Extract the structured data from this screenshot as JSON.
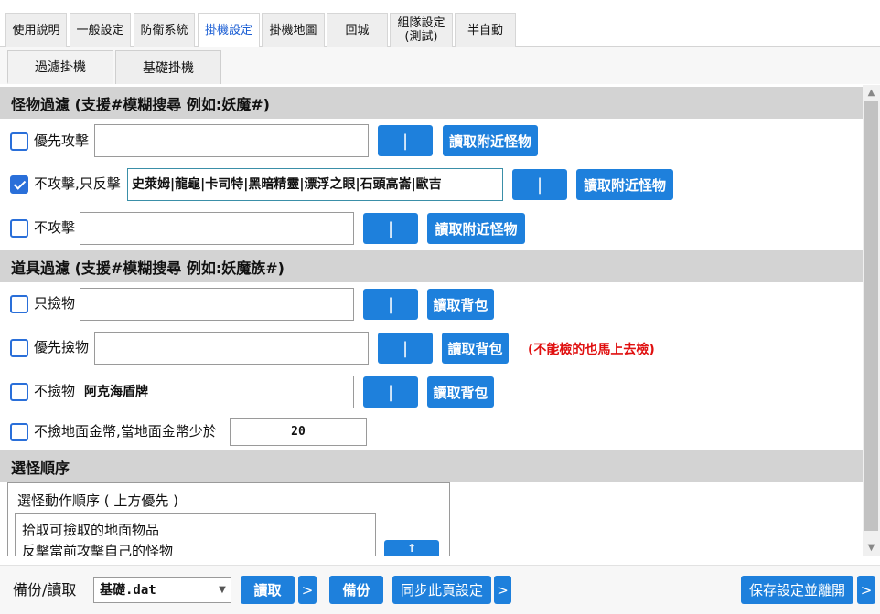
{
  "top_tabs": [
    {
      "label": "使用說明"
    },
    {
      "label": "一般設定"
    },
    {
      "label": "防衛系統"
    },
    {
      "label": "掛機設定"
    },
    {
      "label": "掛機地圖"
    },
    {
      "label": "回城"
    },
    {
      "label": "組隊設定\n(測試)"
    },
    {
      "label": "半自動"
    }
  ],
  "active_top_tab": "掛機設定",
  "sub_tabs": [
    {
      "label": "過濾掛機"
    },
    {
      "label": "基礎掛機"
    }
  ],
  "active_sub_tab": "過濾掛機",
  "monster_filter": {
    "title": "怪物過濾 (支援#模糊搜尋 例如:妖魔#)",
    "rows": [
      {
        "label": "優先攻擊",
        "checked": false,
        "value": "",
        "bar_label": "|",
        "read_label": "讀取附近怪物"
      },
      {
        "label": "不攻擊,只反擊",
        "checked": true,
        "value": "史萊姆|龍龜|卡司特|黑暗精靈|漂浮之眼|石頭高崙|歐吉",
        "bar_label": "|",
        "read_label": "讀取附近怪物"
      },
      {
        "label": "不攻擊",
        "checked": false,
        "value": "",
        "bar_label": "|",
        "read_label": "讀取附近怪物"
      }
    ]
  },
  "item_filter": {
    "title": "道具過濾 (支援#模糊搜尋 例如:妖魔族#)",
    "rows": [
      {
        "label": "只撿物",
        "checked": false,
        "value": "",
        "bar_label": "|",
        "read_label": "讀取背包"
      },
      {
        "label": "優先撿物",
        "checked": false,
        "value": "",
        "bar_label": "|",
        "read_label": "讀取背包",
        "note": "(不能檢的也馬上去檢)"
      },
      {
        "label": "不撿物",
        "checked": false,
        "value": "阿克海盾牌",
        "bar_label": "|",
        "read_label": "讀取背包"
      }
    ],
    "gold": {
      "label": "不撿地面金幣,當地面金幣少於",
      "checked": false,
      "value": "20"
    }
  },
  "monster_order": {
    "title": "選怪順序",
    "group_label": "選怪動作順序 ( 上方優先 )",
    "items": [
      "拾取可撿取的地面物品",
      "反擊當前攻擊自己的怪物"
    ],
    "up_label": "↑"
  },
  "bottom": {
    "backup_label": "備份/讀取",
    "file_value": "基礎.dat",
    "read_btn": "讀取",
    "more_label": ">",
    "backup_btn": "備份",
    "sync_btn": "同步此頁設定",
    "save_btn": "保存設定並離開"
  },
  "colors": {
    "accent": "#1e80dc",
    "warning": "#e01010",
    "active_tab_text": "#1c5fd4"
  }
}
